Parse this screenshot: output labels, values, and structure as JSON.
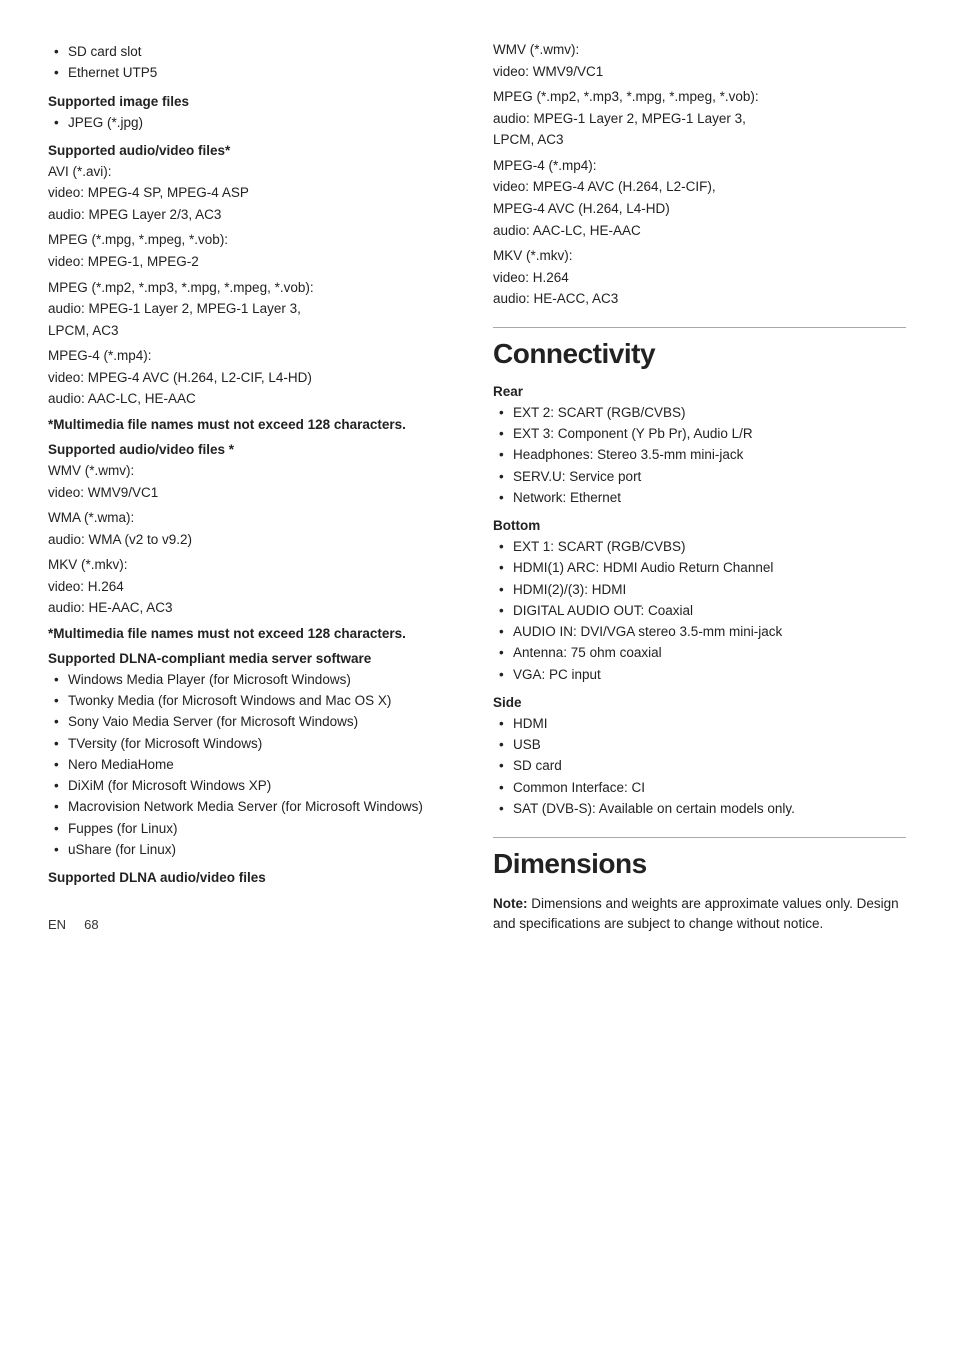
{
  "left": {
    "intro_bullets": [
      "SD card slot",
      "Ethernet UTP5"
    ],
    "supported_image_files_heading": "Supported image files",
    "supported_image_bullets": [
      "JPEG (*.jpg)"
    ],
    "supported_av_heading1": "Supported audio/video files*",
    "av_blocks1": [
      {
        "format": "AVI (*.avi):",
        "lines": [
          "video: MPEG-4 SP, MPEG-4 ASP",
          "audio: MPEG Layer 2/3, AC3"
        ]
      },
      {
        "format": "MPEG (*.mpg, *.mpeg, *.vob):",
        "lines": [
          "video: MPEG-1, MPEG-2"
        ]
      },
      {
        "format": "MPEG (*.mp2, *.mp3, *.mpg, *.mpeg, *.vob):",
        "lines": [
          "audio: MPEG-1 Layer 2, MPEG-1 Layer 3,",
          "LPCM, AC3"
        ]
      },
      {
        "format": "MPEG-4 (*.mp4):",
        "lines": [
          "video: MPEG-4 AVC (H.264, L2-CIF, L4-HD)",
          "audio: AAC-LC, HE-AAC"
        ]
      }
    ],
    "note1": "*Multimedia file names must not exceed 128 characters.",
    "supported_av_heading2": "Supported audio/video files *",
    "av_blocks2": [
      {
        "format": "WMV (*.wmv):",
        "lines": [
          "video: WMV9/VC1"
        ]
      },
      {
        "format": "WMA (*.wma):",
        "lines": [
          "audio: WMA (v2 to v9.2)"
        ]
      },
      {
        "format": "MKV (*.mkv):",
        "lines": [
          "video: H.264",
          "audio: HE-AAC, AC3"
        ]
      }
    ],
    "note2": "*Multimedia file names must not exceed 128 characters.",
    "dlna_heading": "Supported DLNA-compliant media server software",
    "dlna_bullets": [
      "Windows Media Player (for Microsoft Windows)",
      "Twonky Media (for Microsoft Windows and Mac OS X)",
      "Sony Vaio Media Server (for Microsoft Windows)",
      "TVersity (for Microsoft Windows)",
      "Nero MediaHome",
      "DiXiM (for Microsoft Windows XP)",
      "Macrovision Network Media Server (for Microsoft Windows)",
      "Fuppes (for Linux)",
      "uShare (for Linux)"
    ],
    "dlna_av_heading": "Supported DLNA audio/video files"
  },
  "right": {
    "dlna_av_blocks": [
      {
        "format": "WMV (*.wmv):",
        "lines": [
          "video: WMV9/VC1"
        ]
      },
      {
        "format": "MPEG (*.mp2, *.mp3, *.mpg, *.mpeg, *.vob):",
        "lines": [
          "audio: MPEG-1 Layer 2, MPEG-1 Layer 3,",
          "LPCM, AC3"
        ]
      },
      {
        "format": "MPEG-4 (*.mp4):",
        "lines": [
          "video: MPEG-4 AVC (H.264, L2-CIF),",
          "MPEG-4 AVC (H.264, L4-HD)",
          "audio: AAC-LC, HE-AAC"
        ]
      },
      {
        "format": "MKV (*.mkv):",
        "lines": [
          "video: H.264",
          "audio: HE-ACC, AC3"
        ]
      }
    ],
    "connectivity_heading": "Connectivity",
    "rear_heading": "Rear",
    "rear_bullets": [
      "EXT 2: SCART (RGB/CVBS)",
      "EXT 3: Component (Y Pb Pr), Audio L/R",
      "Headphones: Stereo 3.5-mm mini-jack",
      "SERV.U: Service port",
      "Network: Ethernet"
    ],
    "bottom_heading": "Bottom",
    "bottom_bullets": [
      "EXT 1: SCART (RGB/CVBS)",
      "HDMI(1) ARC: HDMI Audio Return Channel",
      "HDMI(2)/(3): HDMI",
      "DIGITAL AUDIO OUT: Coaxial",
      "AUDIO IN: DVI/VGA stereo 3.5-mm mini-jack",
      "Antenna: 75 ohm coaxial",
      "VGA: PC input"
    ],
    "side_heading": "Side",
    "side_bullets": [
      "HDMI",
      "USB",
      "SD card",
      "Common Interface: CI",
      "SAT (DVB-S): Available on certain models only."
    ],
    "dimensions_heading": "Dimensions",
    "dimensions_note_bold": "Note:",
    "dimensions_note_text": " Dimensions and weights are approximate values only. Design and specifications are subject to change without notice."
  },
  "footer": {
    "label": "EN",
    "page": "68"
  }
}
